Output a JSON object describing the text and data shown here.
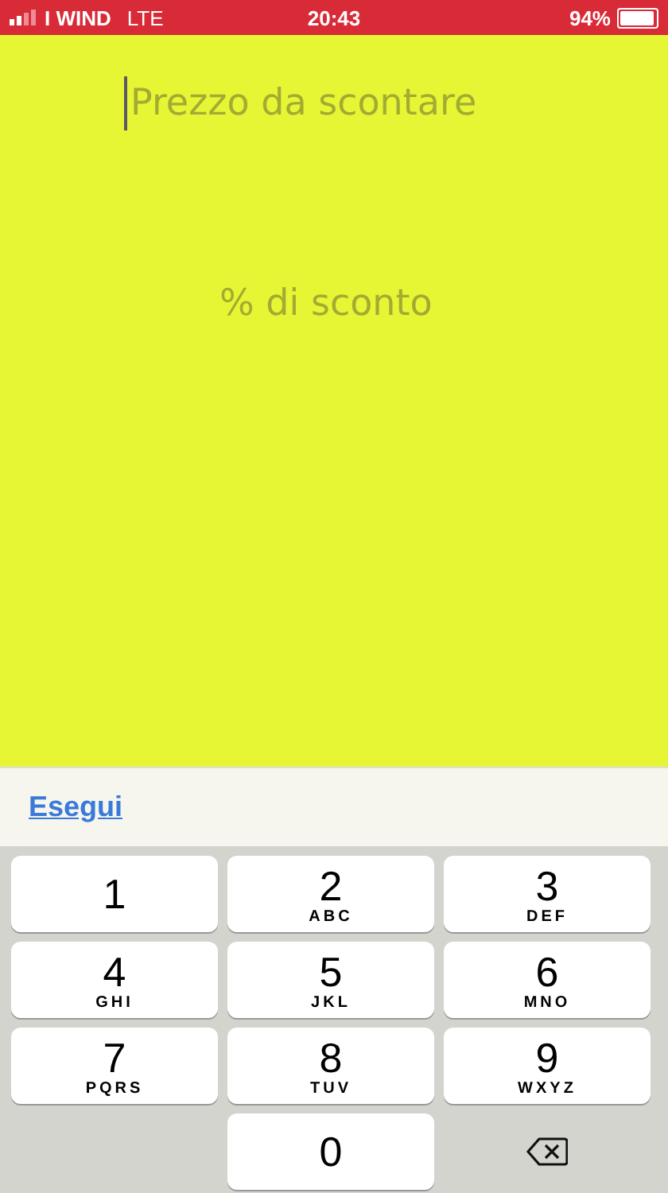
{
  "status_bar": {
    "carrier": "I WIND",
    "network": "LTE",
    "time": "20:43",
    "battery": "94%"
  },
  "fields": [
    {
      "placeholder": "Prezzo da scontare",
      "focused": true
    },
    {
      "placeholder": "% di sconto",
      "focused": false
    }
  ],
  "toolbar": {
    "action": "Esegui"
  },
  "keys": [
    {
      "kind": "key",
      "digit": "1"
    },
    {
      "kind": "key",
      "digit": "2",
      "letters": "ABC"
    },
    {
      "kind": "key",
      "digit": "3",
      "letters": "DEF"
    },
    {
      "kind": "key",
      "digit": "4",
      "letters": "GHI"
    },
    {
      "kind": "key",
      "digit": "5",
      "letters": "JKL"
    },
    {
      "kind": "key",
      "digit": "6",
      "letters": "MNO"
    },
    {
      "kind": "key",
      "digit": "7",
      "letters": "PQRS"
    },
    {
      "kind": "key",
      "digit": "8",
      "letters": "TUV"
    },
    {
      "kind": "key",
      "digit": "9",
      "letters": "WXYZ"
    },
    {
      "kind": "blank"
    },
    {
      "kind": "key",
      "digit": "0"
    },
    {
      "kind": "delete"
    }
  ]
}
